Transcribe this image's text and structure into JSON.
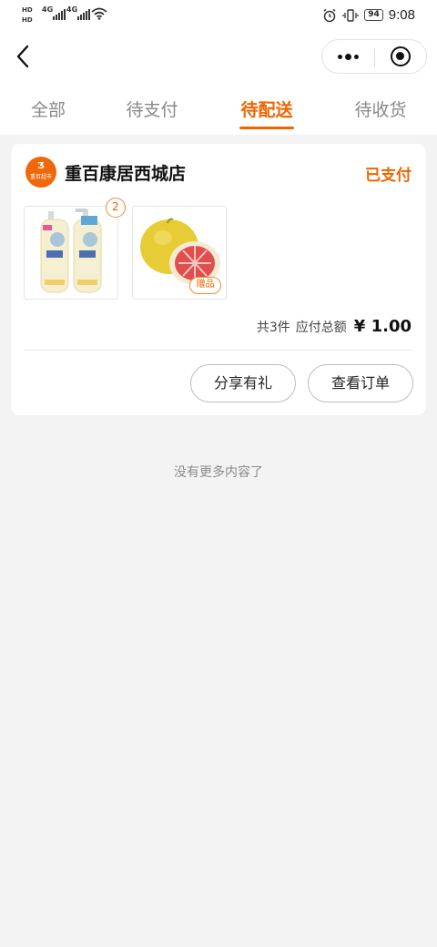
{
  "status_bar": {
    "hd1": "HD",
    "hd2": "HD",
    "net1": "4G",
    "net2": "4G",
    "battery": "94",
    "time": "9:08"
  },
  "nav": {
    "back_icon": "chevron-left-icon",
    "more_icon": "more-dots-icon",
    "close_icon": "target-circle-icon"
  },
  "tabs": [
    {
      "label": "全部",
      "active": false
    },
    {
      "label": "待支付",
      "active": false
    },
    {
      "label": "待配送",
      "active": true
    },
    {
      "label": "待收货",
      "active": false
    }
  ],
  "order": {
    "logo_text": "重百超市",
    "logo_mark": "Ʒ",
    "store_name": "重百康居西城店",
    "status": "已支付",
    "items": [
      {
        "image": "shampoo-bottles",
        "quantity": "2"
      },
      {
        "image": "pomelo",
        "tag": "赠品"
      }
    ],
    "count_text": "共3件",
    "total_label": "应付总额",
    "total_amount": "¥ 1.00",
    "share_label": "分享有礼",
    "view_label": "查看订单"
  },
  "footer_text": "没有更多内容了",
  "colors": {
    "accent": "#f06400",
    "background": "#f3f3f3",
    "card": "#ffffff"
  }
}
